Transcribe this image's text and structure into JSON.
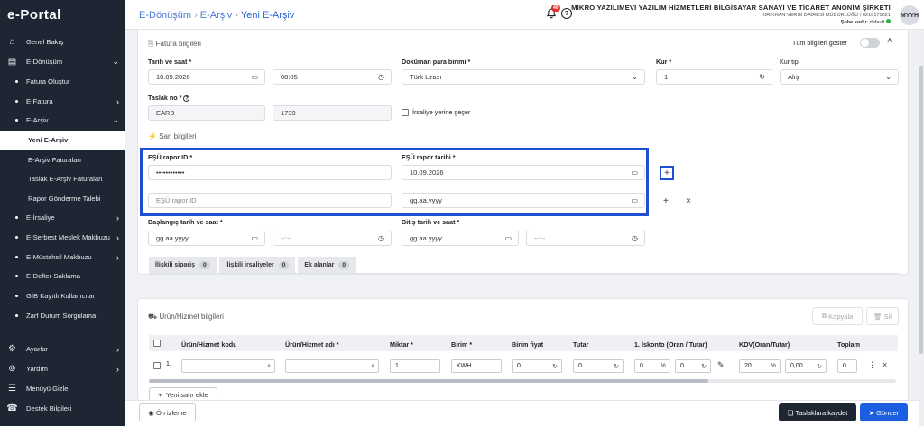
{
  "app": {
    "logo": "e-Portal"
  },
  "sidebar": {
    "items": [
      {
        "label": "Genel Bakış",
        "icon": "home-icon",
        "chev": ""
      },
      {
        "label": "E-Dönüşüm",
        "icon": "document-icon",
        "chev": "⌄"
      },
      {
        "label": "Fatura Oluştur",
        "chev": ""
      },
      {
        "label": "E-Fatura",
        "chev": "›"
      },
      {
        "label": "E-Arşiv",
        "chev": "⌄"
      },
      {
        "label": "Yeni E-Arşiv",
        "chev": ""
      },
      {
        "label": "E-Arşiv Faturaları",
        "chev": ""
      },
      {
        "label": "Taslak E-Arşiv Faturaları",
        "chev": ""
      },
      {
        "label": "Rapor Gönderme Talebi",
        "chev": ""
      },
      {
        "label": "E-İrsaliye",
        "chev": "›"
      },
      {
        "label": "E-Serbest Meslek Makbuzu",
        "chev": "›"
      },
      {
        "label": "E-Müstahsil Makbuzu",
        "chev": "›"
      },
      {
        "label": "E-Defter Saklama",
        "chev": ""
      },
      {
        "label": "GİB Kayıtlı Kullanıcılar",
        "chev": ""
      },
      {
        "label": "Zarf Durum Sorgulama",
        "chev": ""
      },
      {
        "label": "Ayarlar",
        "icon": "gear-icon",
        "chev": "›"
      },
      {
        "label": "Yardım",
        "icon": "help-circle-icon",
        "chev": "›"
      },
      {
        "label": "Menüyü Gizle",
        "icon": "menu-icon",
        "chev": ""
      },
      {
        "label": "Destek Bilgileri",
        "icon": "phone-icon",
        "chev": ""
      }
    ]
  },
  "header": {
    "breadcrumb": [
      "E-Dönüşüm",
      "E-Arşiv",
      "Yeni E-Arşiv"
    ],
    "notif_count": "40",
    "company_name": "MİKRO YAZILIMEVİ YAZILIM HİZMETLERİ BİLGİSAYAR SANAYİ VE TİCARET ANONİM ŞİRKETİ",
    "tax_office": "KIRIKHAN VERGİ DAİRESİ MÜDÜRLÜĞÜ / 6210175621",
    "branch_label": "Şube kodu:",
    "branch_value": "default",
    "avatar": "MYYH"
  },
  "invoice": {
    "section_title": "Fatura bilgileri",
    "show_all_label": "Tüm bilgileri göster",
    "date_label": "Tarih ve saat *",
    "date_value": "10.09.2026",
    "time_value": "08:05",
    "currency_label": "Doküman para birimi *",
    "currency_value": "Türk Lirası",
    "rate_label": "Kur *",
    "rate_value": "1",
    "rate_type_label": "Kur tipi",
    "rate_type_value": "Alış",
    "draft_label": "Taslak no *",
    "draft_prefix": "EARB",
    "draft_number": "1739",
    "waybill_label": "İrsaliye yerine geçer"
  },
  "charge": {
    "section_title": "Şarj bilgileri",
    "esu_id_label": "EŞÜ rapor ID *",
    "esu_id_value": "••••••••••••",
    "esu_date_label": "EŞÜ rapor tarihi *",
    "esu_date_value": "10.09.2026",
    "esu_id_placeholder": "EŞÜ rapor ID",
    "date_placeholder": "gg.aa.yyyy",
    "time_placeholder": "--:--",
    "start_label": "Başlangıç tarih ve saat *",
    "end_label": "Bitiş tarih ve saat *",
    "add_symbol": "+",
    "remove_symbol": "×"
  },
  "tabs": [
    {
      "label": "İlişkili sipariş",
      "count": "0"
    },
    {
      "label": "İlişkili irsaliyeler",
      "count": "0"
    },
    {
      "label": "Ek alanlar",
      "count": "0"
    }
  ],
  "products": {
    "section_title": "Ürün/Hizmet bilgileri",
    "copy_label": "Kopyala",
    "delete_label": "Sil",
    "columns": [
      "Ürün/Hizmet kodu",
      "Ürün/Hizmet adı *",
      "Miktar *",
      "Birim *",
      "Birim fiyat",
      "Tutar",
      "1. İskonto (Oran / Tutar)",
      "KDV(Oran/Tutar)",
      "Toplam"
    ],
    "row": {
      "index": "1.",
      "qty": "1",
      "unit": "KWH",
      "price": "0",
      "amount": "0",
      "disc_rate": "0",
      "disc_amount": "0",
      "vat_rate": "20",
      "vat_amount": "0,00",
      "total": "0"
    },
    "add_row_label": "Yeni satır ekle"
  },
  "footer": {
    "preview_label": "Ön izleme",
    "save_draft_label": "Taslaklara kaydet",
    "send_label": "Gönder"
  },
  "colors": {
    "sidebar": "#1e2633",
    "accent": "#1a5fe0",
    "highlight": "#1d4fd0",
    "status_green": "#2fb344"
  }
}
